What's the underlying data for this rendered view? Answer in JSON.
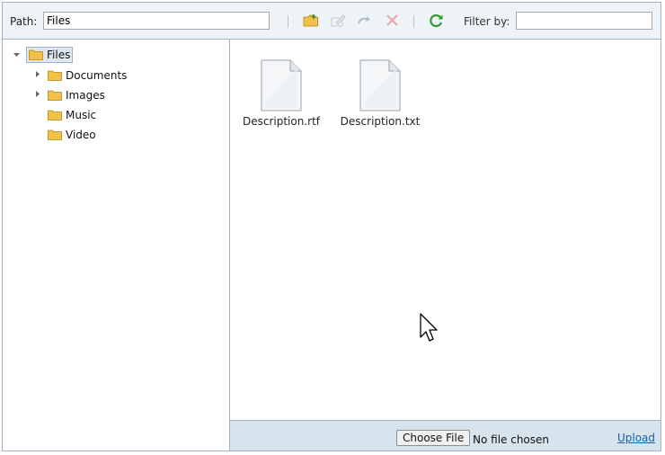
{
  "toolbar": {
    "path_label": "Path:",
    "path_value": "Files",
    "filter_label": "Filter by:",
    "filter_value": "",
    "icons": [
      "new-folder-icon",
      "rename-icon",
      "move-icon",
      "delete-icon",
      "refresh-icon"
    ]
  },
  "tree": {
    "root": "Files",
    "items": [
      {
        "label": "Documents",
        "expandable": true
      },
      {
        "label": "Images",
        "expandable": true
      },
      {
        "label": "Music",
        "expandable": false
      },
      {
        "label": "Video",
        "expandable": false
      }
    ]
  },
  "files": [
    {
      "name": "Description.rtf"
    },
    {
      "name": "Description.txt"
    }
  ],
  "upload": {
    "choose_label": "Choose File",
    "no_file_label": "No file chosen",
    "upload_link": "Upload"
  },
  "colors": {
    "toolbar_bg": "#eef3f8",
    "border": "#a4b1c0",
    "upload_bar_bg": "#d7e3ed",
    "folder": "#f1c24a",
    "link": "#1a5fa8"
  }
}
